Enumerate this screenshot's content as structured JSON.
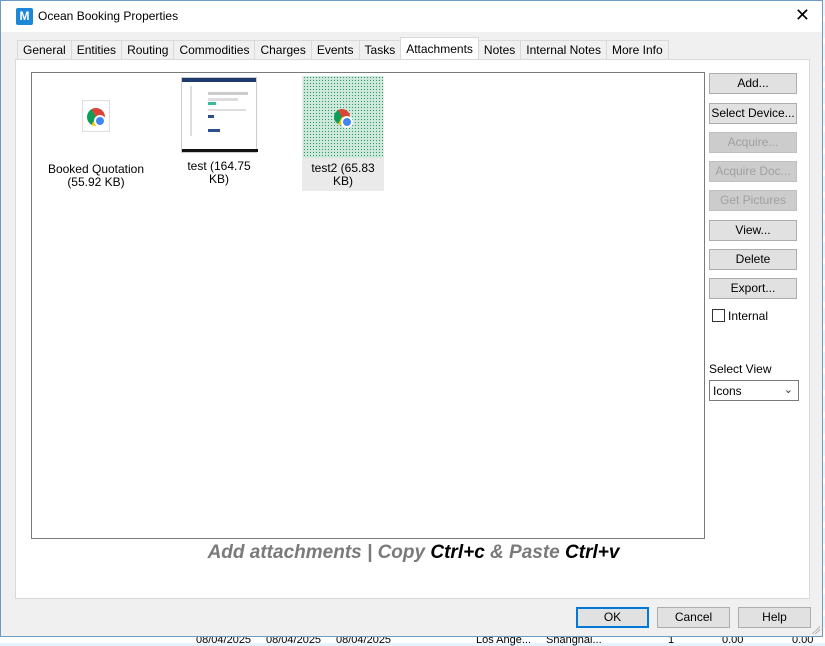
{
  "window": {
    "title": "Ocean Booking Properties",
    "icon_letter": "M",
    "close_glyph": "✕"
  },
  "tabs": [
    {
      "label": "General"
    },
    {
      "label": "Entities"
    },
    {
      "label": "Routing"
    },
    {
      "label": "Commodities"
    },
    {
      "label": "Charges"
    },
    {
      "label": "Events"
    },
    {
      "label": "Tasks"
    },
    {
      "label": "Attachments",
      "active": true
    },
    {
      "label": "Notes"
    },
    {
      "label": "Internal Notes"
    },
    {
      "label": "More Info"
    }
  ],
  "attachments": [
    {
      "label": "Booked Quotation (55.92 KB)",
      "kind": "chrome-doc"
    },
    {
      "label": "test (164.75 KB)",
      "kind": "screenshot"
    },
    {
      "label": "test2 (65.83 KB)",
      "kind": "chrome-selected"
    }
  ],
  "hint": {
    "part1": "Add attachments | Copy ",
    "ctrl_c": "Ctrl+c",
    "part2": " & Paste ",
    "ctrl_v": "Ctrl+v"
  },
  "side_buttons": {
    "add": "Add...",
    "select_device": "Select Device...",
    "acquire": "Acquire...",
    "acquire_doc": "Acquire Doc...",
    "get_pictures": "Get Pictures",
    "view": "View...",
    "delete": "Delete",
    "export": "Export..."
  },
  "internal_checkbox": {
    "label": "Internal",
    "checked": false
  },
  "select_view": {
    "label": "Select View",
    "value": "Icons"
  },
  "footer_buttons": {
    "ok": "OK",
    "cancel": "Cancel",
    "help": "Help"
  },
  "background_row": [
    "08/04/2025",
    "08/04/2025",
    "08/04/2025",
    "Los Ange...",
    "Shanghai...",
    "1",
    "0.00",
    "0.00"
  ],
  "colors": {
    "accent": "#0078d7",
    "app_icon": "#1e88d8",
    "selection": "#e5e5e5"
  }
}
